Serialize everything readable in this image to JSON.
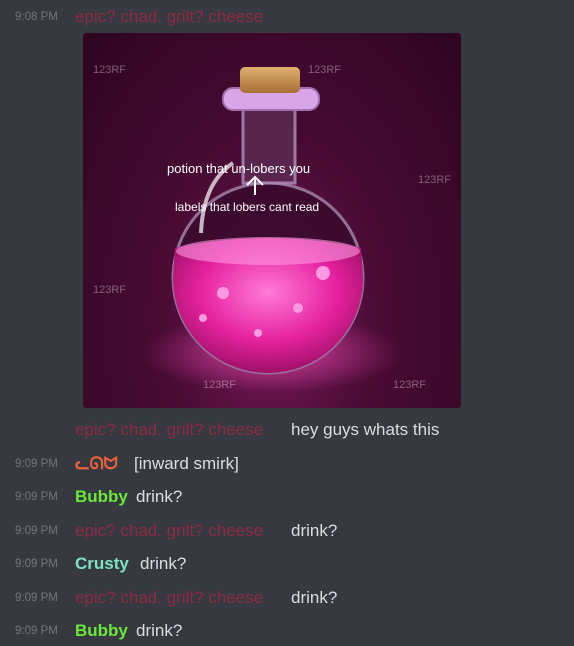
{
  "messages": [
    {
      "time": "9:08 PM",
      "author": "epic? chad. grilt? cheese",
      "text": "",
      "color": "#8e2a45"
    },
    {
      "time": "",
      "author": "epic? chad. grilt? cheese",
      "text": "hey guys whats this",
      "color": "#8e2a45"
    },
    {
      "time": "9:09 PM",
      "author": "ᓚᘏᗢ",
      "text": "[inward smirk]",
      "color": "#e9623c"
    },
    {
      "time": "9:09 PM",
      "author": "Bubby",
      "text": "drink?",
      "color": "#6ce83a"
    },
    {
      "time": "9:09 PM",
      "author": "epic? chad. grilt? cheese",
      "text": "drink?",
      "color": "#8e2a45"
    },
    {
      "time": "9:09 PM",
      "author": "Crusty",
      "text": "drink?",
      "color": "#7ee3c2"
    },
    {
      "time": "9:09 PM",
      "author": "epic? chad. grilt? cheese",
      "text": "drink?",
      "color": "#8e2a45"
    },
    {
      "time": "9:09 PM",
      "author": "Bubby",
      "text": "drink?",
      "color": "#6ce83a"
    }
  ],
  "image": {
    "label_top": "potion that un-lobers you",
    "label_bottom": "labels that lobers cant read",
    "watermark": "123RF"
  }
}
